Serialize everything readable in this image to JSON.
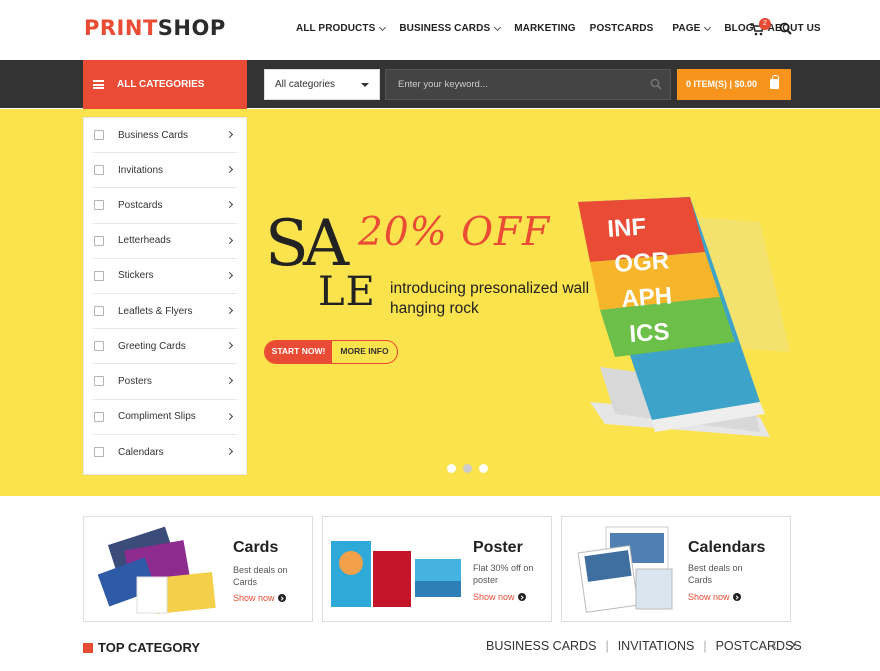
{
  "brand": {
    "part1": "PRINT",
    "part2": "SHOP"
  },
  "nav": {
    "items": [
      {
        "label": "ALL PRODUCTS",
        "dropdown": true
      },
      {
        "label": "BUSINESS CARDS",
        "dropdown": true
      },
      {
        "label": "MARKETING",
        "dropdown": false
      },
      {
        "label": "POSTCARDS",
        "dropdown": false
      },
      {
        "label": "PAGE",
        "dropdown": true
      },
      {
        "label": "BLOG",
        "dropdown": false
      },
      {
        "label": "ABOUT US",
        "dropdown": false
      }
    ],
    "cart_count": "2"
  },
  "toolbar": {
    "all_categories": "ALL CATEGORIES",
    "category_select": "All categories",
    "search_placeholder": "Enter your keyword...",
    "cart_summary": "0 ITEM(S) | $0.00"
  },
  "categories": [
    "Business Cards",
    "Invitations",
    "Postcards",
    "Letterheads",
    "Stickers",
    "Leaflets & Flyers",
    "Greeting Cards",
    "Posters",
    "Compliment Slips",
    "Calendars"
  ],
  "hero": {
    "sale_a": "SA",
    "sale_b": "LE",
    "discount": "20% OFF",
    "intro": "introducing presonalized wall hanging rock",
    "start_button": "START NOW!",
    "more_button": "MORE INFO",
    "slide_count": 3,
    "active_slide": 2
  },
  "promos": [
    {
      "title": "Cards",
      "desc": "Best deals on Cards",
      "link": "Show now"
    },
    {
      "title": "Poster",
      "desc": "Flat 30% off on poster",
      "link": "Show now"
    },
    {
      "title": "Calendars",
      "desc": "Best deals on Cards",
      "link": "Show now"
    }
  ],
  "top_category": {
    "title": "TOP CATEGORY",
    "tabs": [
      "BUSINESS CARDS",
      "INVITATIONS",
      "POSTCARDSS"
    ]
  },
  "colors": {
    "accent": "#e94b35",
    "hero_bg": "#fbe34d",
    "bar": "#333333",
    "cart": "#f7941d"
  }
}
